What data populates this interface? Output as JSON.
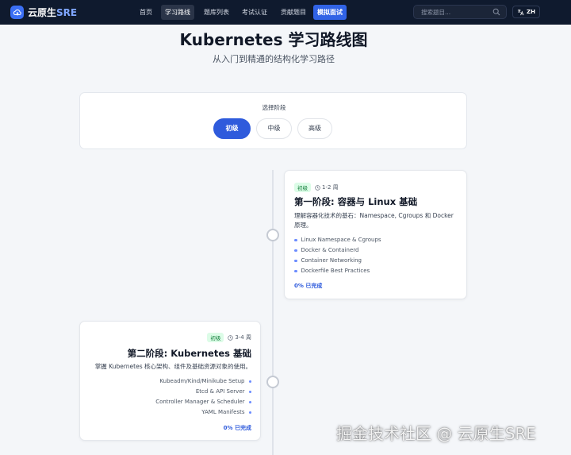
{
  "nav": {
    "logo_text": "云原生",
    "logo_accent": "SRE",
    "items": [
      {
        "label": "首页"
      },
      {
        "label": "学习路线"
      },
      {
        "label": "题库列表"
      },
      {
        "label": "考试认证"
      },
      {
        "label": "贡献题目"
      },
      {
        "label": "模拟面试"
      }
    ],
    "active_item": "学习路线",
    "search_placeholder": "搜索题目...",
    "lang_label": "ZH"
  },
  "page": {
    "title": "Kubernetes 学习路线图",
    "subtitle": "从入门到精通的结构化学习路径"
  },
  "stage_selector": {
    "label": "选择阶段",
    "options": [
      {
        "label": "初级"
      },
      {
        "label": "中级"
      },
      {
        "label": "高级"
      }
    ],
    "selected": "初级"
  },
  "phases": [
    {
      "level": "初级",
      "duration": "1-2 周",
      "title": "第一阶段: 容器与 Linux 基础",
      "description": "理解容器化技术的基石：Namespace, Cgroups 和 Docker 原理。",
      "topics": [
        "Linux Namespace & Cgroups",
        "Docker & Containerd",
        "Container Networking",
        "Dockerfile Best Practices"
      ],
      "progress_text": "0% 已完成"
    },
    {
      "level": "初级",
      "duration": "3-4 周",
      "title": "第二阶段: Kubernetes 基础",
      "description": "掌握 Kubernetes 核心架构、组件及基础资源对象的使用。",
      "topics": [
        "Kubeadm/Kind/Minikube Setup",
        "Etcd & API Server",
        "Controller Manager & Scheduler",
        "YAML Manifests"
      ],
      "progress_text": "0% 已完成"
    }
  ],
  "watermark": "掘金技术社区 @ 云原生SRE",
  "colors": {
    "nav_bg": "#0f1a2e",
    "accent": "#2f5bdc",
    "badge_bg": "#dcfce7",
    "badge_text": "#15803d",
    "page_bg": "#f4f6f9"
  }
}
